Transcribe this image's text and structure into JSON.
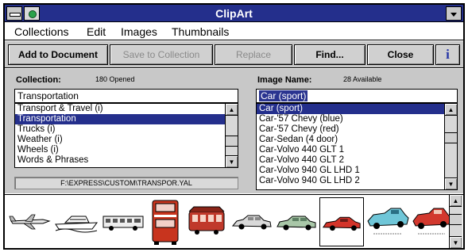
{
  "window": {
    "title": "ClipArt"
  },
  "menu": [
    "Collections",
    "Edit",
    "Images",
    "Thumbnails"
  ],
  "toolbar": {
    "add": "Add to Document",
    "save": "Save to Collection",
    "replace": "Replace",
    "find": "Find...",
    "close": "Close",
    "info": "i"
  },
  "collection": {
    "label": "Collection:",
    "status": "180 Opened",
    "value": "Transportation",
    "items": [
      "Transport & Travel (i)",
      "Transportation",
      "Trucks (i)",
      "Weather (i)",
      "Wheels (i)",
      "Words & Phrases"
    ],
    "selected_index": 1,
    "path": "F:\\EXPRESS\\CUSTOM\\TRANSPOR.YAL"
  },
  "image": {
    "label": "Image Name:",
    "status": "28 Available",
    "value": "Car (sport)",
    "items": [
      "Car (sport)",
      "Car-'57 Chevy (blue)",
      "Car-'57 Chevy (red)",
      "Car-Sedan (4 door)",
      "Car-Volvo 440 GLT 1",
      "Car-Volvo 440 GLT 2",
      "Car-Volvo 940 GL LHD 1",
      "Car-Volvo 940 GL LHD 2"
    ],
    "selected_index": 0
  },
  "scroll_arrows": {
    "up": "▲",
    "down": "▼"
  },
  "thumbnails": [
    "jet-plane-icon",
    "speedboat-icon",
    "bus-icon",
    "double-decker-bus-icon",
    "trolley-car-icon",
    "sedan-car-icon",
    "green-car-icon",
    "sport-car-icon",
    "chevy-blue-icon",
    "chevy-red-icon"
  ],
  "thumb_selected_index": 7,
  "colors": {
    "titlebar": "#242f8c",
    "selection": "#242f8c",
    "face": "#c8c8c8",
    "info": "#2635a6"
  }
}
